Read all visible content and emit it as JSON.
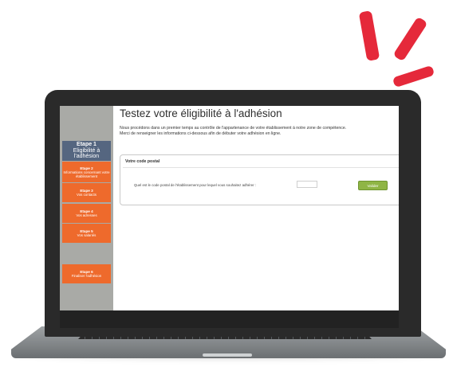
{
  "page": {
    "title": "Testez votre éligibilité à l'adhésion",
    "intro_line1": "Nous procédons dans un premier temps au contrôle de l'appartenance de votre établissement à notre zone de compétence.",
    "intro_line2": "Merci de renseigner les informations ci-dessous afin de débuter votre adhésion en ligne."
  },
  "steps": [
    {
      "title": "Etape 1",
      "label": "Eligibilité à l'adhésion",
      "state": "active",
      "color": "#556680"
    },
    {
      "title": "Etape 2",
      "label": "Informations concernant votre établissement",
      "color": "#ee6a2c"
    },
    {
      "title": "Etape 3",
      "label": "Vos contacts",
      "color": "#ee6a2c"
    },
    {
      "title": "Etape 4",
      "label": "Vos adresses",
      "color": "#ee6a2c"
    },
    {
      "title": "Etape 5",
      "label": "Vos salariés",
      "color": "#ee6a2c"
    },
    {
      "title": "Etape 6",
      "label": "Finaliser l'adhésion",
      "color": "#ee6a2c"
    }
  ],
  "form": {
    "section_title": "Votre code postal",
    "question": "Quel est le code postal de l'établissement pour lequel vous souhaitez adhérer :",
    "postal_code_value": "",
    "submit_label": "Valider",
    "submit_color": "#8fb545"
  },
  "decoration": {
    "accent_color": "#e5293a"
  }
}
